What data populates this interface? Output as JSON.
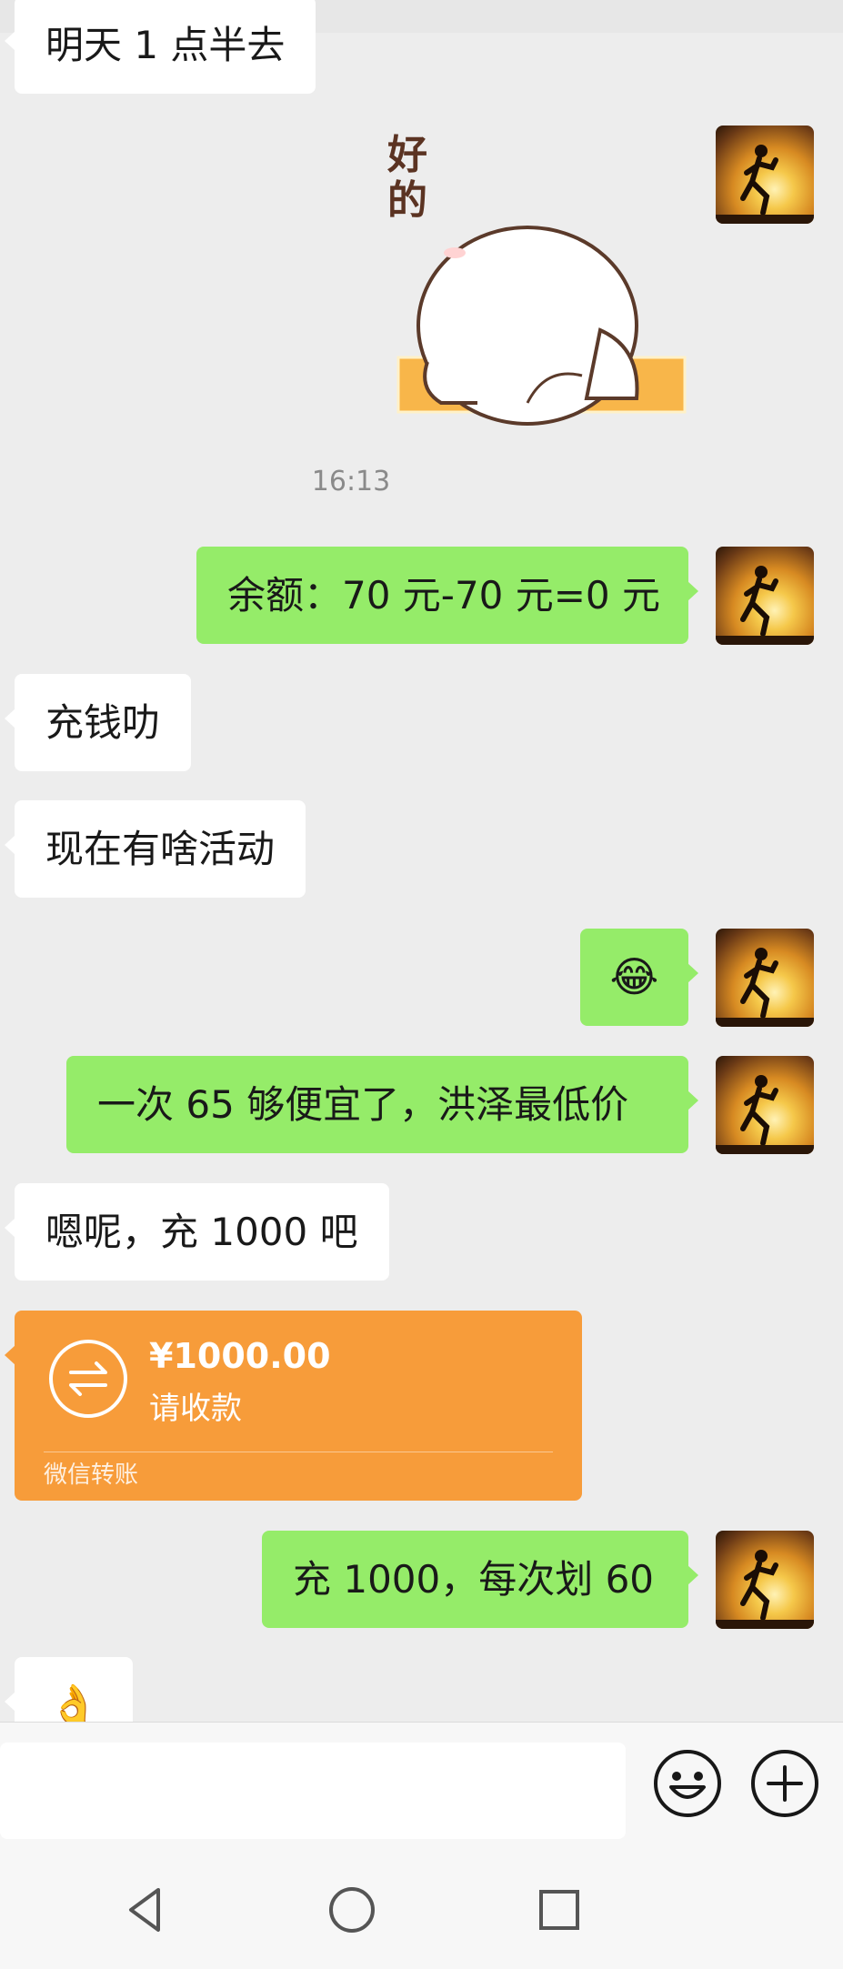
{
  "messages": {
    "m1": "明天 1 点半去",
    "sticker_text": "好的",
    "timestamp": "16:13",
    "m2": "余额：70 元-70 元=0 元",
    "m3": "充钱叻",
    "m4": "现在有啥活动",
    "m5_emoji": "😂",
    "m6": "一次 65 够便宜了，洪泽最低价",
    "m7": "嗯呢，充 1000 吧",
    "m9": "充 1000，每次划 60",
    "m10_emoji": "👌"
  },
  "transfer": {
    "amount": "¥1000.00",
    "status": "请收款",
    "caption": "微信转账"
  },
  "input": {
    "placeholder": ""
  },
  "colors": {
    "outgoing_bubble": "#95ec69",
    "incoming_bubble": "#ffffff",
    "transfer_card": "#f79c3a",
    "chat_background": "#ededed"
  },
  "icons": {
    "emoji_button": "smiley-icon",
    "plus_button": "plus-circle-icon",
    "nav_back": "triangle-back-icon",
    "nav_home": "circle-home-icon",
    "nav_recents": "square-recents-icon"
  }
}
